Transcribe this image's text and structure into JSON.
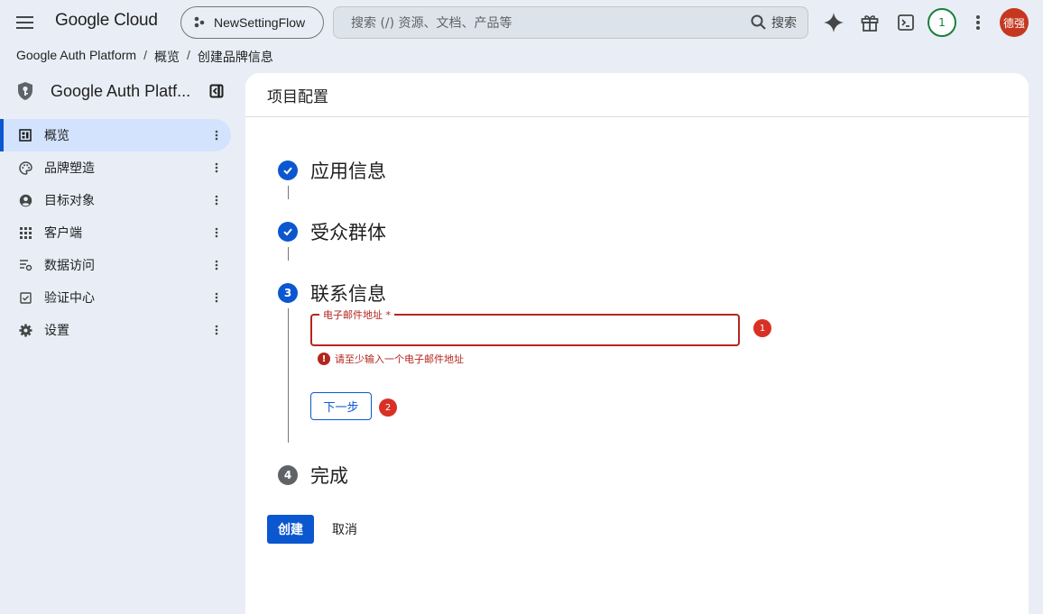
{
  "topbar": {
    "logo": "Google Cloud",
    "project": "NewSettingFlow",
    "search_placeholder": "搜索 (/) 资源、文档、产品等",
    "search_button": "搜索",
    "notification_count": "1",
    "avatar_text": "德强"
  },
  "breadcrumb": [
    "Google Auth Platform",
    "概览",
    "创建品牌信息"
  ],
  "sidebar": {
    "title": "Google Auth Platf...",
    "items": [
      {
        "label": "概览",
        "icon": "dashboard-icon"
      },
      {
        "label": "品牌塑造",
        "icon": "palette-icon"
      },
      {
        "label": "目标对象",
        "icon": "account-circle-icon"
      },
      {
        "label": "客户端",
        "icon": "apps-grid-icon"
      },
      {
        "label": "数据访问",
        "icon": "data-settings-icon"
      },
      {
        "label": "验证中心",
        "icon": "verified-checkbox-icon"
      },
      {
        "label": "设置",
        "icon": "gear-icon"
      }
    ]
  },
  "main": {
    "title": "项目配置",
    "steps": [
      {
        "label": "应用信息",
        "state": "done"
      },
      {
        "label": "受众群体",
        "state": "done"
      },
      {
        "label": "联系信息",
        "state": "active",
        "number": "3"
      },
      {
        "label": "完成",
        "state": "pending",
        "number": "4"
      }
    ],
    "email_label": "电子邮件地址 *",
    "email_value": "",
    "error": "请至少输入一个电子邮件地址",
    "next": "下一步",
    "annotation_1": "1",
    "annotation_2": "2",
    "create": "创建",
    "cancel": "取消"
  },
  "colors": {
    "primary": "#0b57d0",
    "error": "#b3261e",
    "annotation": "#d93025",
    "background": "#e9eef6"
  }
}
